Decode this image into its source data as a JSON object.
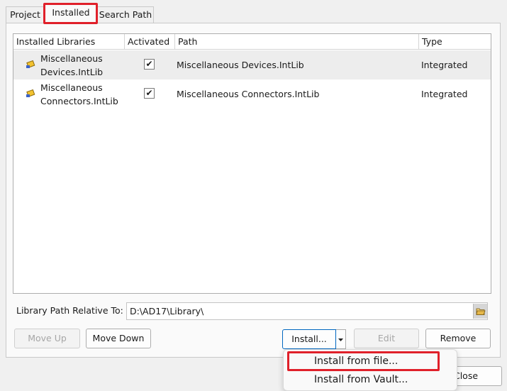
{
  "tabs": [
    {
      "label": "Project"
    },
    {
      "label": "Installed"
    },
    {
      "label": "Search Path"
    }
  ],
  "table": {
    "headers": [
      "Installed Libraries",
      "Activated",
      "Path",
      "Type"
    ],
    "rows": [
      {
        "name_line1": "Miscellaneous",
        "name_line2": "Devices.IntLib",
        "activated": "✔",
        "path": "Miscellaneous Devices.IntLib",
        "type": "Integrated"
      },
      {
        "name_line1": "Miscellaneous",
        "name_line2": "Connectors.IntLib",
        "activated": "✔",
        "path": "Miscellaneous Connectors.IntLib",
        "type": "Integrated"
      }
    ]
  },
  "library_path": {
    "label": "Library Path Relative To:",
    "value": "D:\\AD17\\Library\\"
  },
  "buttons": {
    "move_up": {
      "label": "Move Up"
    },
    "move_down": {
      "label": "Move Down"
    },
    "install": {
      "label": "Install..."
    },
    "edit": {
      "label": "Edit"
    },
    "remove": {
      "label": "Remove"
    },
    "close": {
      "label": "Close"
    }
  },
  "install_menu": [
    {
      "label": "Install from file..."
    },
    {
      "label": "Install from Vault..."
    }
  ],
  "colors": {
    "highlight": "#e0202a",
    "selected_row": "#ededed",
    "primary_border": "#0067c0"
  }
}
